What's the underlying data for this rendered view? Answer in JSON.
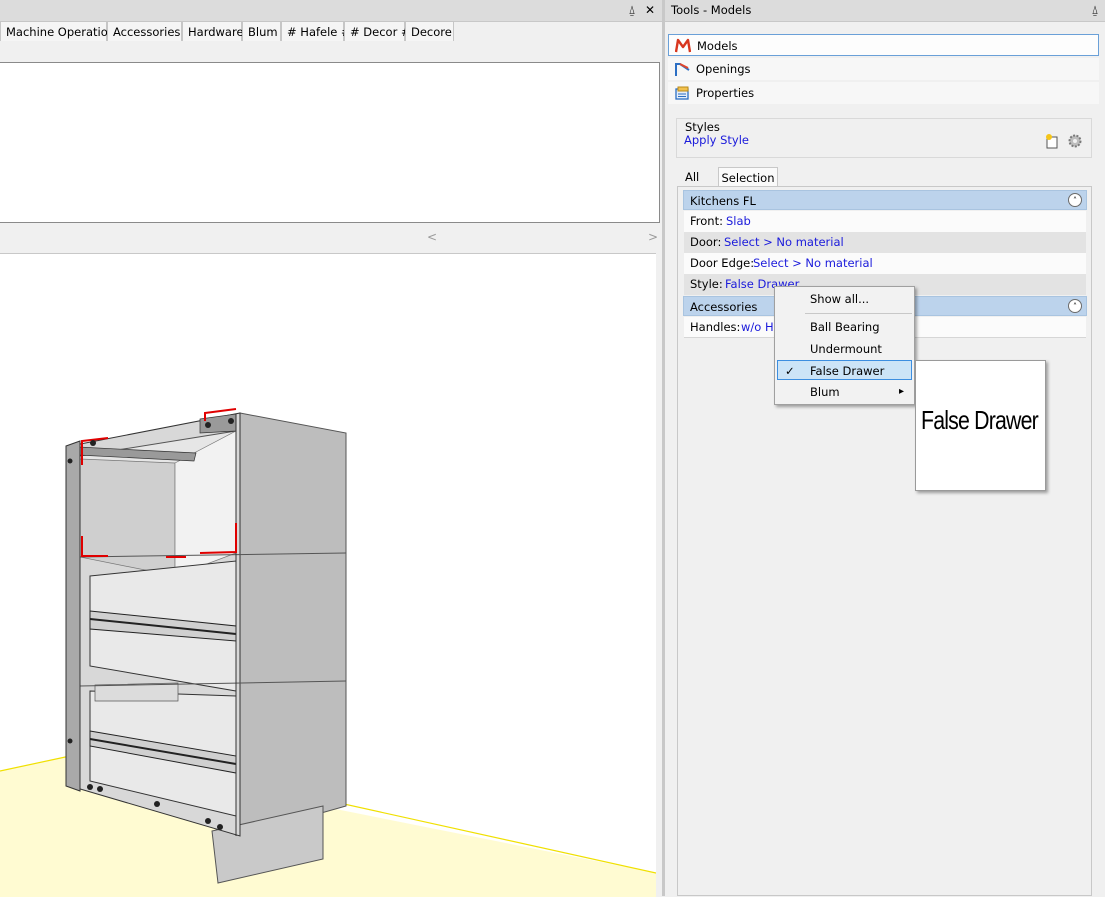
{
  "left_panel": {
    "tabs": [
      "Machine Operation",
      "Accessories",
      "Hardware",
      "Blum",
      "# Hafele #",
      "# Decor #",
      "Decore"
    ],
    "pin_glyph": "⍙",
    "close_glyph": "✕",
    "scroll_left_glyph": "<",
    "scroll_right_glyph": ">"
  },
  "right_panel": {
    "title": "Tools - Models",
    "pin_glyph": "⍙",
    "nav": {
      "models": "Models",
      "openings": "Openings",
      "properties": "Properties"
    },
    "styles": {
      "group_label": "Styles",
      "apply_style": "Apply Style"
    },
    "tabs": {
      "all": "All",
      "selection": "Selection"
    },
    "kitchens": {
      "header": "Kitchens FL",
      "front_label": "Front:",
      "front_value": "Slab",
      "door_label": "Door:",
      "door_value": "Select > No material",
      "door_edge_label": "Door Edge:",
      "door_edge_value": "Select > No material",
      "style_label": "Style:",
      "style_value": "False Drawer"
    },
    "accessories": {
      "header": "Accessories",
      "handles_label": "Handles:",
      "handles_value": "w/o Ha"
    },
    "collapse_glyph": "˄"
  },
  "context_menu": {
    "show_all": "Show all...",
    "ball_bearing": "Ball Bearing",
    "undermount": "Undermount",
    "false_drawer": "False Drawer",
    "blum": "Blum",
    "check_glyph": "✓",
    "submenu_glyph": "▸"
  },
  "tooltip": {
    "text": "False Drawer"
  },
  "colors": {
    "link": "#1a1adb",
    "section_header": "#bcd3ec",
    "menu_highlight": "#cce4f7",
    "floor": "#fffbd2",
    "cut_lines": "#e00000"
  },
  "icons": [
    "pin-icon",
    "close-icon",
    "models-icon",
    "openings-icon",
    "properties-icon",
    "new-style-icon",
    "gear-icon",
    "collapse-icon",
    "checkmark-icon",
    "submenu-arrow-icon"
  ]
}
